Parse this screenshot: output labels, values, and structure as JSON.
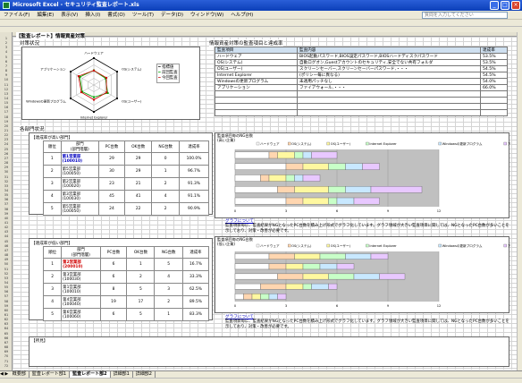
{
  "window": {
    "title": "Microsoft Excel - セキュリティ監査レポート.xls"
  },
  "menu": [
    "ファイル(F)",
    "編集(E)",
    "表示(V)",
    "挿入(I)",
    "書式(O)",
    "ツール(T)",
    "データ(D)",
    "ウィンドウ(W)",
    "ヘルプ(H)"
  ],
  "help_placeholder": "質問を入力してください",
  "header": {
    "report_title": "【監査レポート】情報資産対策",
    "section_target": "対策状況",
    "section_items": "情報資産対策の監査項目と達成率",
    "section_dept": "各部門状況",
    "remarks": "【所見】"
  },
  "radar": {
    "legend": [
      "指標値",
      "前回監査",
      "今回監査"
    ],
    "axes": [
      "ハードウェア",
      "OS(システム)",
      "OS(ユーザー)",
      "Internet Explorer",
      "Windowsの更新プログラム",
      "アプリケーション"
    ]
  },
  "items_table": {
    "headers": [
      "監査項目",
      "監査内容",
      "達成率"
    ],
    "rows": [
      [
        "ハードウェア",
        "BIOS起動パスワード,BIOS設定パスワード,BIOSハードディスクパスワード",
        "53.5%"
      ],
      [
        "OS(システム)",
        "自動ログオン,Guestアカウントのセキュリティ,安全でない共有フォルダ",
        "53.5%"
      ],
      [
        "OS(ユーザー)",
        "スクリーンセーバー,スクリーンセーバーパスワード,・・・",
        "54.5%"
      ],
      [
        "Internet Explorer",
        "(ポリシー毎に異なる)",
        "54.5%"
      ],
      [
        "Windowsの更新プログラム",
        "未適用パッチなし",
        "54.0%"
      ],
      [
        "アプリケーション",
        "ファイアウォール,・・・",
        "66.0%"
      ]
    ]
  },
  "dept1": {
    "caption": "【達成率が高い部門】",
    "headers": [
      "順位",
      "部門\n(部門階層)",
      "PC台数",
      "OK台数",
      "NG台数",
      "達成率"
    ],
    "rows": [
      [
        "1",
        "第1営業部\n(100010)",
        "29",
        "29",
        "0",
        "100.0%"
      ],
      [
        "2",
        "第5営業部\n(100050)",
        "30",
        "29",
        "1",
        "96.7%"
      ],
      [
        "3",
        "第2営業部\n(100020)",
        "23",
        "21",
        "2",
        "91.3%"
      ],
      [
        "4",
        "第3営業部\n(100030)",
        "45",
        "41",
        "4",
        "91.1%"
      ],
      [
        "5",
        "第5営業部\n(100050)",
        "24",
        "22",
        "2",
        "90.9%"
      ]
    ],
    "chart_title": "監査項目毎のNG台数\n(高い企業)",
    "note_link": "グラフについて",
    "note": "監査項目毎に、監査結果がNGとなったPC台数を積み上げ形式でグラフ化しています。グラフ領域が大きい監査項目に関しては、NGとなったPC台数が多いことを示しており、対策・改善が必要です。"
  },
  "dept2": {
    "caption": "【達成率が低い部門】",
    "headers": [
      "順位",
      "部門\n(部門階層)",
      "PC台数",
      "OK台数",
      "NG台数",
      "達成率"
    ],
    "rows": [
      [
        "1",
        "第2営業部\n(200010)",
        "6",
        "1",
        "5",
        "16.7%"
      ],
      [
        "2",
        "第3営業部\n(100030)",
        "6",
        "2",
        "4",
        "33.3%"
      ],
      [
        "3",
        "第1営業部\n(100010)",
        "8",
        "5",
        "3",
        "62.5%"
      ],
      [
        "4",
        "第4営業部\n(100040)",
        "19",
        "17",
        "2",
        "89.5%"
      ],
      [
        "5",
        "第6営業部\n(100060)",
        "6",
        "5",
        "1",
        "83.3%"
      ]
    ],
    "chart_title": "監査項目毎のNG台数\n(低い企業)",
    "note_link": "グラフについて",
    "note": "監査項目毎に、監査結果がNGとなったPC台数を積み上げ形式でグラフ化しています。グラフ領域が大きい監査項目に関しては、NGとなったPC台数が多いことを示しており、対策・改善が必要です。"
  },
  "bar_legend": [
    "ハードウェア",
    "OS(システム)",
    "OS(ユーザー)",
    "Internet Explorer",
    "Windowsの更新プログラム",
    "アプリケーション"
  ],
  "colors": {
    "s": [
      "#ffffff",
      "#ffd6b0",
      "#fff8a0",
      "#c8ffc8",
      "#c8e8ff",
      "#e8c8ff"
    ]
  },
  "chart_data": [
    {
      "type": "bar",
      "categories": [
        "第1営業部",
        "第5営業部",
        "第2営業部",
        "第3営業部",
        "第5営業部"
      ],
      "xlim": [
        0,
        12
      ],
      "ticks": [
        "0",
        "3",
        "6",
        "9",
        "12"
      ],
      "series": [
        {
          "name": "ハードウェア",
          "values": [
            2.0,
            3.0,
            1.5,
            2.5,
            3.0
          ]
        },
        {
          "name": "OS(システム)",
          "values": [
            0.5,
            1.0,
            0.5,
            1.0,
            1.0
          ]
        },
        {
          "name": "OS(ユーザー)",
          "values": [
            1.0,
            1.5,
            1.0,
            2.0,
            1.5
          ]
        },
        {
          "name": "Internet Explorer",
          "values": [
            0.5,
            1.0,
            0.5,
            1.0,
            0.5
          ]
        },
        {
          "name": "Windowsの更新プログラム",
          "values": [
            0.5,
            1.0,
            0.5,
            1.5,
            1.0
          ]
        },
        {
          "name": "アプリケーション",
          "values": [
            1.5,
            1.0,
            1.0,
            3.0,
            1.5
          ]
        }
      ]
    },
    {
      "type": "bar",
      "categories": [
        "第2営業部",
        "第3営業部",
        "第1営業部",
        "第4営業部",
        "第6営業部"
      ],
      "xlim": [
        0,
        12
      ],
      "ticks": [
        "0",
        "3",
        "6",
        "9",
        "12"
      ],
      "series": [
        {
          "name": "ハードウェア",
          "values": [
            2.0,
            2.0,
            2.5,
            1.5,
            0.5
          ]
        },
        {
          "name": "OS(システム)",
          "values": [
            1.5,
            1.0,
            1.5,
            1.5,
            0.5
          ]
        },
        {
          "name": "OS(ユーザー)",
          "values": [
            1.5,
            1.0,
            1.5,
            1.0,
            0.5
          ]
        },
        {
          "name": "Internet Explorer",
          "values": [
            1.5,
            1.0,
            1.5,
            0.5,
            0.5
          ]
        },
        {
          "name": "Windowsの更新プログラム",
          "values": [
            1.5,
            1.0,
            1.5,
            1.0,
            0.5
          ]
        },
        {
          "name": "アプリケーション",
          "values": [
            1.0,
            1.0,
            1.5,
            0.5,
            0.5
          ]
        }
      ]
    }
  ],
  "sheet_tabs": [
    "概要部",
    "監査レポート部1",
    "監査レポート部2",
    "詳細部1",
    "詳細部2"
  ],
  "active_tab_index": 2
}
